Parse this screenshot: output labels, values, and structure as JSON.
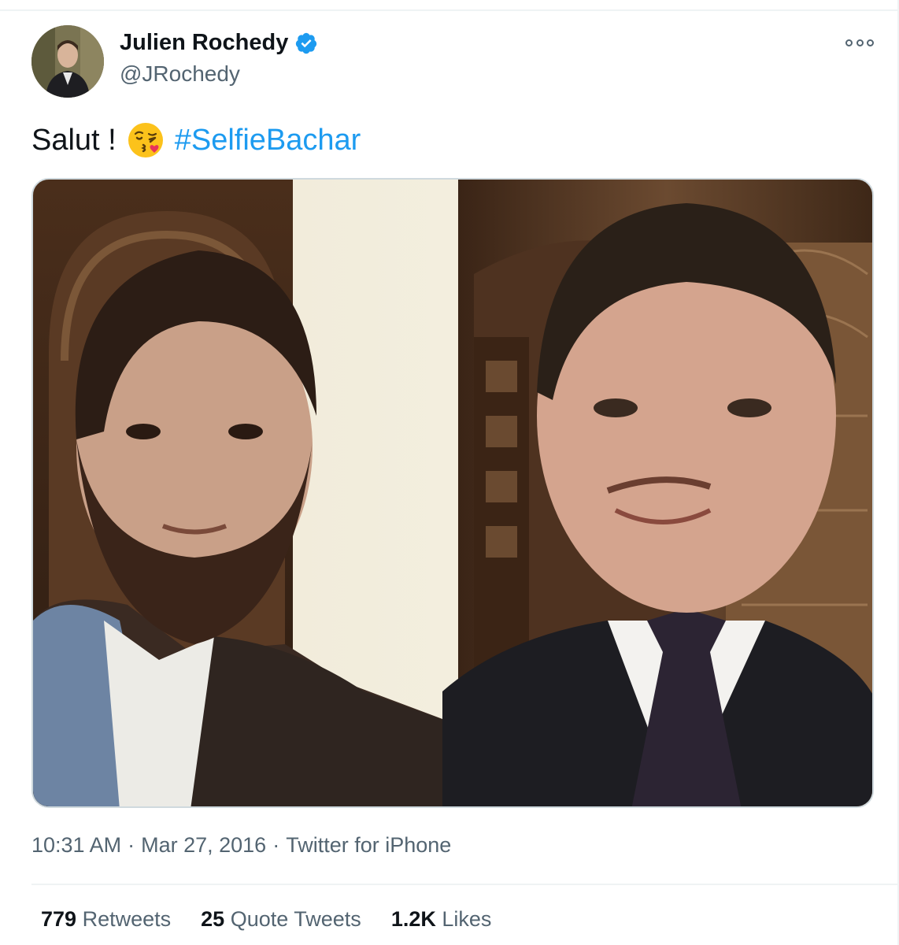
{
  "author": {
    "name": "Julien Rochedy",
    "handle": "@JRochedy",
    "verified": true
  },
  "tweet": {
    "text": "Salut !",
    "emoji": "face-throwing-a-kiss-emoji",
    "hashtag": "#SelfieBachar",
    "time": "10:31 AM",
    "date": "Mar 27, 2016",
    "source": "Twitter for iPhone",
    "separator": "·"
  },
  "stats": {
    "retweets_count": "779",
    "retweets_label": "Retweets",
    "quotes_count": "25",
    "quotes_label": "Quote Tweets",
    "likes_count": "1.2K",
    "likes_label": "Likes"
  },
  "colors": {
    "accent": "#1d9bf0",
    "text": "#0f1419",
    "secondary": "#536471",
    "border": "#eff3f4"
  }
}
